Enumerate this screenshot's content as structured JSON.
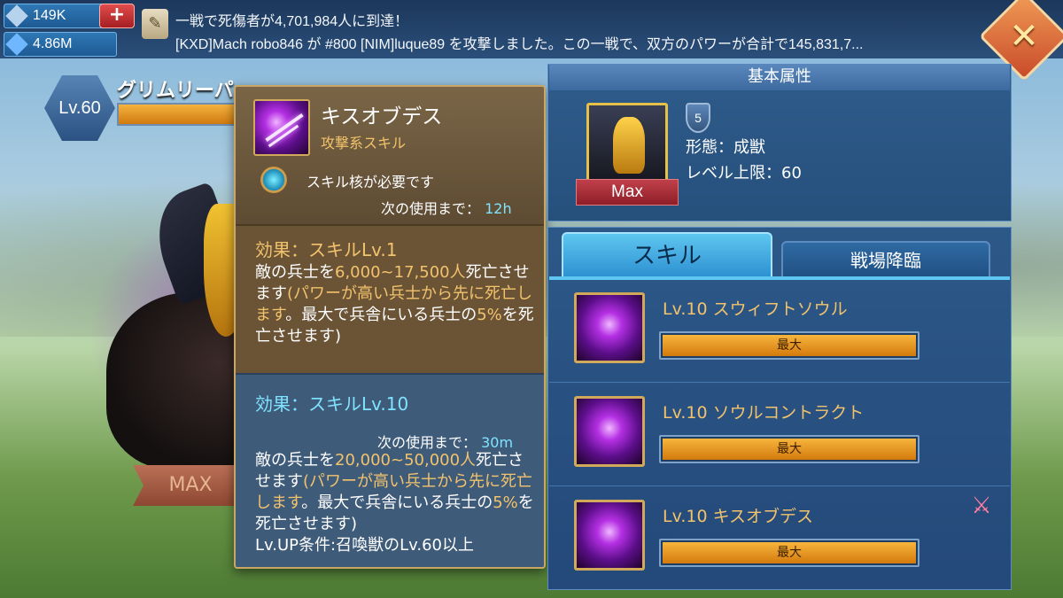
{
  "resources": {
    "food": "149K",
    "gems": "4.86M"
  },
  "news": {
    "line1": "一戦で死傷者が4,701,984人に到達！",
    "line2": "[KXD]Mach robo846 が #800 [NIM]luque89 を攻撃しました。この一戦で、双方のパワーが合計で145,831,7..."
  },
  "beast": {
    "level": "Lv.60",
    "name": "グリムリーパ",
    "max_label": "MAX"
  },
  "tooltip": {
    "title": "キスオブデス",
    "subtitle": "攻撃系スキル",
    "requirement": "スキル核が必要です",
    "cooldown_label": "次の使用まで：",
    "cooldown_1": "12h",
    "effect1_title": "効果：スキルLv.1",
    "effect1": {
      "p1": "敵の兵士を",
      "range": "6,000~17,500人",
      "p2": "死亡させます",
      "paren": "(パワーが高い兵士から先に死亡します",
      "p3": "。最大で兵舎にいる兵士の",
      "pct": "5%",
      "p4": "を死亡させます)"
    },
    "effect2_title": "効果：スキルLv.10",
    "cooldown_2": "30m",
    "effect2": {
      "p1": "敵の兵士を",
      "range": "20,000~50,000人",
      "p2": "死亡させます",
      "paren": "(パワーが高い兵士から先に死亡します",
      "p3": "。最大で兵舎にいる兵士の",
      "pct": "5%",
      "p4": "を死亡させます)"
    },
    "upgrade_req": "Lv.UP条件:召喚獣のLv.60以上"
  },
  "attributes": {
    "header": "基本属性",
    "max_label": "Max",
    "rank": "5",
    "form": "形態：成獣",
    "level_cap": "レベル上限：60"
  },
  "tabs": {
    "skills": "スキル",
    "battle": "戦場降臨"
  },
  "skills": [
    {
      "label": "Lv.10 スウィフトソウル",
      "bar": "最大",
      "progress": 1.0
    },
    {
      "label": "Lv.10 ソウルコントラクト",
      "bar": "最大",
      "progress": 1.0
    },
    {
      "label": "Lv.10 キスオブデス",
      "bar": "最大",
      "progress": 1.0
    }
  ],
  "icons": {
    "close": "close-icon",
    "plus": "plus-icon",
    "scroll": "scroll-icon",
    "fight": "crossed-swords-icon"
  },
  "colors": {
    "gold": "#f2c36c",
    "cyan": "#7fe3ff",
    "bar": "#d37a0d"
  }
}
